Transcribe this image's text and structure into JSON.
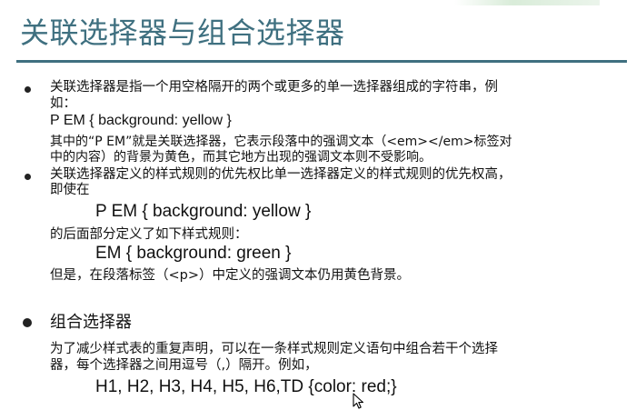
{
  "slide": {
    "title": "关联选择器与组合选择器",
    "section1": {
      "line1": "关联选择器是指一个用空格隔开的两个或更多的单一选择器组成的字符串，例",
      "line2": "如：",
      "code": "P EM { background: yellow }",
      "desc1": "其中的“P EM”就是关联选择器，它表示段落中的强调文本（<em></em>标签对",
      "desc2": "中的内容）的背景为黄色，而其它地方出现的强调文本则不受影响。"
    },
    "section2": {
      "line1": "关联选择器定义的样式规则的优先权比单一选择器定义的样式规则的优先权高，",
      "line2": "即使在",
      "code1": "P EM { background: yellow }",
      "middle": "的后面部分定义了如下样式规则：",
      "code2": "EM { background: green }",
      "conclusion": "但是，在段落标签（<p>）中定义的强调文本仍用黄色背景。"
    },
    "section3": {
      "heading": "组合选择器",
      "line1": "为了减少样式表的重复声明，可以在一条样式规则定义语句中组合若干个选择",
      "line2": "器，每个选择器之间用逗号（,）隔开。例如，",
      "code": "H1, H2, H3, H4, H5, H6,TD {color: red;}"
    }
  },
  "colors": {
    "title": "#3f7080",
    "text": "#111111",
    "background": "#ffffff"
  },
  "icons": {
    "cursor": "mouse-pointer-icon"
  }
}
